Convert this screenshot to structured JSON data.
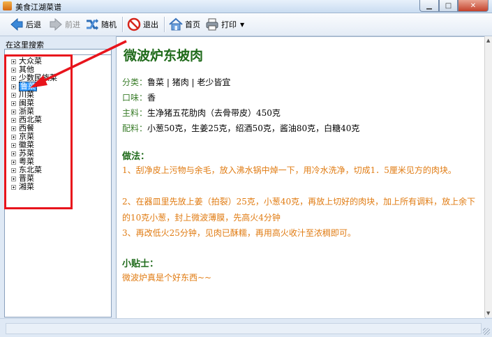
{
  "window": {
    "title": "美食江湖菜谱"
  },
  "toolbar": {
    "back": "后退",
    "forward": "前进",
    "random": "随机",
    "exit": "退出",
    "home": "首页",
    "print": "打印"
  },
  "search": {
    "label": "在这里搜索",
    "value": ""
  },
  "tree": {
    "items": [
      "大众菜",
      "其他",
      "少数民族菜",
      "鲁菜",
      "川菜",
      "闽菜",
      "浙菜",
      "西北菜",
      "西餐",
      "京菜",
      "徽菜",
      "苏菜",
      "粤菜",
      "东北菜",
      "晋菜",
      "湘菜"
    ],
    "selected_index": 3
  },
  "recipe": {
    "title": "微波炉东坡肉",
    "category_label": "分类：",
    "category_value": "鲁菜 | 猪肉 | 老少皆宜",
    "taste_label": "口味：",
    "taste_value": "香",
    "main_label": "主料：",
    "main_value": "生净猪五花肋肉（去骨带皮）450克",
    "aux_label": "配料：",
    "aux_value": "小葱50克，生姜25克，绍酒50克，酱油80克，白糖40克",
    "method_heading": "做法：",
    "steps": [
      "1、刮净皮上污物与余毛，放入沸水锅中焯一下，用冷水洗净，切成1．5厘米见方的肉块。",
      "2、在器皿里先放上姜（拍裂）25克，小葱40克，再放上切好的肉块，加上所有调料，放上余下的10克小葱，封上微波薄膜，先高火4分钟",
      "3、再改低火25分钟，见肉已酥糯，再用高火收汁至浓稠即可。"
    ],
    "tips_heading": "小贴士：",
    "tips_text": "微波炉真是个好东西~~"
  },
  "colors": {
    "title_green": "#1f6a1a",
    "step_orange": "#e07b12",
    "annotation_red": "#e8141c",
    "selection_blue": "#3399ff"
  }
}
